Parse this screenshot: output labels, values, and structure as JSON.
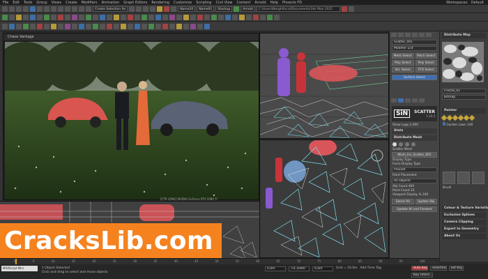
{
  "menubar": {
    "items": [
      "File",
      "Edit",
      "Tools",
      "Group",
      "Views",
      "Create",
      "Modifiers",
      "Animation",
      "Graph Editors",
      "Rendering",
      "Customize",
      "Scripting",
      "Civil View",
      "Content",
      "Arnold",
      "Help",
      "Phoenix FD"
    ],
    "right": [
      "Workspaces:",
      "Default"
    ]
  },
  "toolbar": {
    "selection_set": "Create Selection Se",
    "named_fields": [
      "Name20",
      "Name01",
      "Stackup"
    ],
    "path": "C:\\Users\\Nerghifucal\\Documents\\3ds Max 2021",
    "arnold_label": "Arnold"
  },
  "render_window": {
    "title": "Chaos Vantage",
    "status": "[CTR LONG]  NVIDIA GeForce RTX 2080 Ti"
  },
  "viewports": {
    "top_right_label": "",
    "bottom_right_label": "",
    "bottom_left_label": ""
  },
  "command_panel": {
    "object_name": "Scatter_001",
    "modifier_list": "Modifier List",
    "buttons": [
      "Mesh Select",
      "Patch Select",
      "Poly Select",
      "Poly Select",
      "Vol. Select",
      "FFD Select"
    ],
    "surface_select": "Surface Select",
    "sin_logo": "SiN",
    "scatter_logo": "SCATTER",
    "version": "1.24.0",
    "show_logo": "Show Logo",
    "show_logo_value": "2.000",
    "rollouts": [
      "Stats",
      "Distribute Mesh"
    ],
    "scatter_mesh_label": "Scatter Mesh",
    "scatter_mesh": "Mesh_For_Scatter_001",
    "display_type_label": "Display Type",
    "force_display": "Force Display Type",
    "display_value": "Proxied",
    "point_placement": "Point Placement",
    "all_objects": "All Objects",
    "obj_count_label": "Obj Count",
    "obj_count": "469",
    "point_count_label": "Point Count",
    "point_count": "22",
    "viewport_display_label": "Viewport Display %",
    "viewport_display": "100",
    "select_all": "Select All",
    "update_obj": "Update Obj",
    "update_all": "Update All and Forward"
  },
  "side_panel": {
    "rollouts": [
      "Distribute Map",
      "Painter"
    ],
    "map_name": "Fractal_01",
    "map_type": "Bitmap",
    "garden_label": "Garden Lawn",
    "garden_value": "100",
    "brush_label": "Brush",
    "bottom_rollouts": [
      "Colour & Texture Variation",
      "Exclusion Splines",
      "Camera Clipping",
      "Export to Geometry",
      "About Us"
    ]
  },
  "banner": {
    "text": "CracksLib.com"
  },
  "timeline": {
    "ticks": [
      "0",
      "5",
      "10",
      "15",
      "20",
      "25",
      "30",
      "35",
      "40",
      "45",
      "50",
      "55",
      "60",
      "65",
      "70",
      "75",
      "80",
      "85",
      "90",
      "95",
      "100"
    ],
    "frame": "0 / 100"
  },
  "statusbar": {
    "mini_listener": "MAXScript Mini",
    "selected": "1 Object Selected",
    "hint": "Click and drag to select and move objects",
    "x": "0.0m",
    "y": "+4.109m",
    "z": "0.0m",
    "grid": "Grid = 10.0m",
    "add_time_tag": "Add Time Tag",
    "auto_key": "Auto Key",
    "selected_label": "Selected",
    "set_key": "Set Key",
    "key_filters": "Key Filters..."
  }
}
